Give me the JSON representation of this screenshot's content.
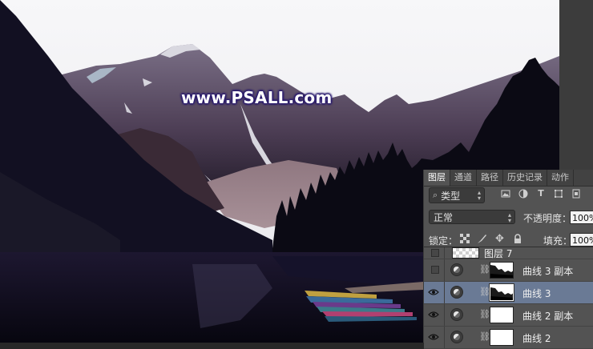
{
  "watermark": "www.PSALL.com",
  "panel": {
    "tabs": [
      "图层",
      "通道",
      "路径",
      "历史记录",
      "动作"
    ],
    "active_tab": "图层",
    "filter": {
      "icon": "search-icon",
      "label": "类型"
    },
    "blend_mode": "正常",
    "opacity_label": "不透明度：",
    "opacity_value": "100%",
    "lock_label": "锁定：",
    "fill_label": "填充：",
    "fill_value": "100%",
    "layers": [
      {
        "name": "图层 7",
        "visible": false,
        "type": "pixel",
        "selected": false
      },
      {
        "name": "曲线 3 副本",
        "visible": false,
        "type": "curves",
        "mask": "dark-sky-mask",
        "selected": false
      },
      {
        "name": "曲线 3",
        "visible": true,
        "type": "curves",
        "mask": "dark-sky-mask",
        "selected": true
      },
      {
        "name": "曲线 2 副本",
        "visible": true,
        "type": "curves",
        "mask": "white-mask",
        "selected": false
      },
      {
        "name": "曲线 2",
        "visible": true,
        "type": "curves",
        "mask": "white-mask",
        "selected": false
      }
    ]
  },
  "colors": {
    "panel_bg": "#535353",
    "selected_layer": "#6a7a95",
    "sky": "#f4f4f6",
    "water": "#0d0a1c"
  }
}
